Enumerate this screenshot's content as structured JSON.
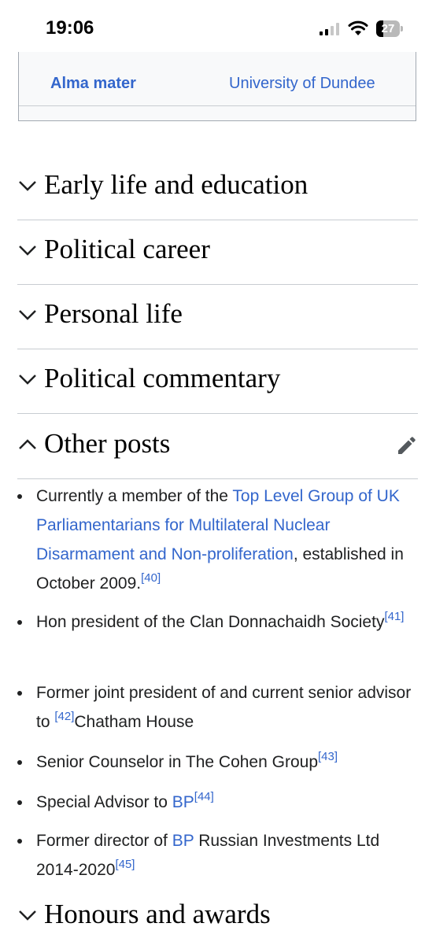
{
  "status_bar": {
    "time": "19:06",
    "battery_level": "27",
    "icons": [
      "cellular-signal-icon",
      "wifi-icon",
      "battery-icon"
    ]
  },
  "infobox": {
    "label": "Alma mater",
    "value": "University of Dundee"
  },
  "sections": [
    {
      "title": "Early life and education",
      "expanded": false
    },
    {
      "title": "Political career",
      "expanded": false
    },
    {
      "title": "Personal life",
      "expanded": false
    },
    {
      "title": "Political commentary",
      "expanded": false
    },
    {
      "title": "Other posts",
      "expanded": true
    },
    {
      "title": "Honours and awards",
      "expanded": false
    }
  ],
  "other_posts": [
    {
      "text_before": "Currently a member of the ",
      "link": "Top Level Group of UK Parliamentarians for Multilateral Nuclear Disarmament and Non-proliferation",
      "text_after": ", established in October 2009.",
      "ref": "[40]"
    },
    {
      "text_before": "Hon president of the Clan Donnachaidh Society",
      "ref": "[41]"
    },
    {
      "text_before": "Former joint president of and current senior advisor to ",
      "ref": "[42]",
      "text_after": "Chatham House"
    },
    {
      "text_before": "Senior Counselor in The Cohen Group",
      "ref": "[43]"
    },
    {
      "text_before": "Special Advisor to ",
      "link": "BP",
      "ref": "[44]"
    },
    {
      "text_before": "Former director of ",
      "link": "BP",
      "text_after": " Russian Investments Ltd 2014-2020",
      "ref": "[45]"
    }
  ],
  "colors": {
    "link": "#3366cc",
    "text": "#202122",
    "divider": "#c8ccd1"
  }
}
